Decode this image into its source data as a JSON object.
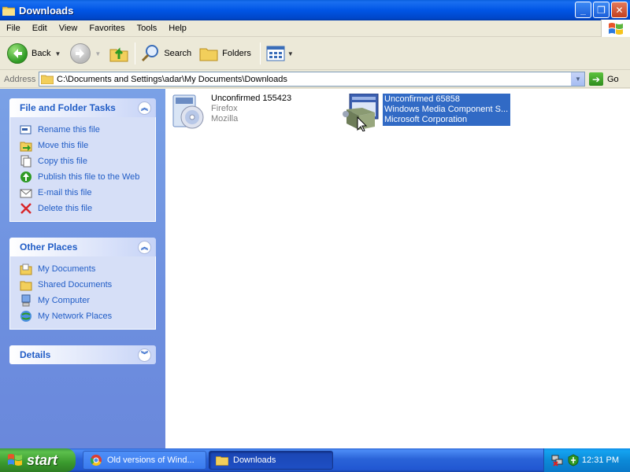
{
  "window": {
    "title": "Downloads",
    "controls": [
      "minimize",
      "maximize",
      "close"
    ]
  },
  "menu": [
    "File",
    "Edit",
    "View",
    "Favorites",
    "Tools",
    "Help"
  ],
  "toolbar": {
    "back": "Back",
    "search": "Search",
    "folders": "Folders"
  },
  "address": {
    "label": "Address",
    "value": "C:\\Documents and Settings\\adar\\My Documents\\Downloads",
    "go": "Go"
  },
  "tasks": {
    "file_folder": {
      "title": "File and Folder Tasks",
      "items": [
        {
          "label": "Rename this file",
          "icon": "rename-icon"
        },
        {
          "label": "Move this file",
          "icon": "move-icon"
        },
        {
          "label": "Copy this file",
          "icon": "copy-icon"
        },
        {
          "label": "Publish this file to the Web",
          "icon": "publish-web-icon"
        },
        {
          "label": "E-mail this file",
          "icon": "email-icon"
        },
        {
          "label": "Delete this file",
          "icon": "delete-icon"
        }
      ]
    },
    "other_places": {
      "title": "Other Places",
      "items": [
        {
          "label": "My Documents",
          "icon": "my-documents-icon"
        },
        {
          "label": "Shared Documents",
          "icon": "shared-documents-icon"
        },
        {
          "label": "My Computer",
          "icon": "my-computer-icon"
        },
        {
          "label": "My Network Places",
          "icon": "network-places-icon"
        }
      ]
    },
    "details": {
      "title": "Details"
    }
  },
  "files": [
    {
      "name": "Unconfirmed 155423",
      "line2": "Firefox",
      "line3": "Mozilla",
      "selected": false,
      "icon": "installer-cd-icon"
    },
    {
      "name": "Unconfirmed 65858",
      "line2": "Windows Media Component S...",
      "line3": "Microsoft Corporation",
      "selected": true,
      "icon": "msi-package-icon"
    }
  ],
  "taskbar": {
    "start": "start",
    "tasks": [
      {
        "label": "Old versions of Wind...",
        "icon": "chrome-icon"
      },
      {
        "label": "Downloads",
        "icon": "folder-icon"
      }
    ],
    "clock": "12:31 PM"
  },
  "colors": {
    "title_bar": "#0055e5",
    "task_pane": "#6d8fdf",
    "link": "#215dc6",
    "selection": "#316ac5",
    "start_button": "#3b9a2e"
  }
}
